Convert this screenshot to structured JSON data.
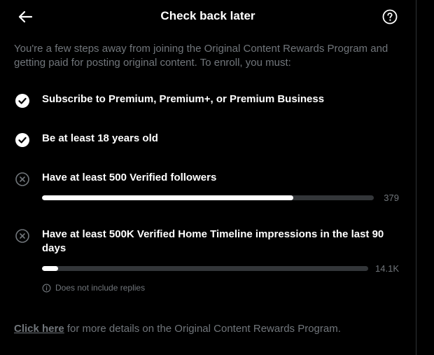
{
  "header": {
    "title": "Check back later",
    "back_icon": "arrow-left-icon",
    "help_icon": "question-circle-icon"
  },
  "intro": "You're a few steps away from joining the Original Content Rewards Program and getting paid for posting original content. To enroll, you must:",
  "requirements": [
    {
      "label": "Subscribe to Premium, Premium+, or Premium Business",
      "status": "complete",
      "icon": "check-circle-icon"
    },
    {
      "label": "Be at least 18 years old",
      "status": "complete",
      "icon": "check-circle-icon"
    },
    {
      "label": "Have at least 500 Verified followers",
      "status": "incomplete",
      "icon": "x-circle-icon",
      "progress": 0.758,
      "value": "379"
    },
    {
      "label": "Have at least 500K Verified Home Timeline impressions in the last 90 days",
      "status": "incomplete",
      "icon": "x-circle-icon",
      "progress": 0.05,
      "value": "14.1K",
      "note": "Does not include replies",
      "note_icon": "info-circle-icon"
    }
  ],
  "footer": {
    "link": "Click here",
    "text": " for more details on the Original Content Rewards Program."
  },
  "colors": {
    "background": "#000000",
    "text_primary": "#ffffff",
    "text_secondary": "#71767b",
    "track": "#333639",
    "fill": "#ffffff"
  }
}
